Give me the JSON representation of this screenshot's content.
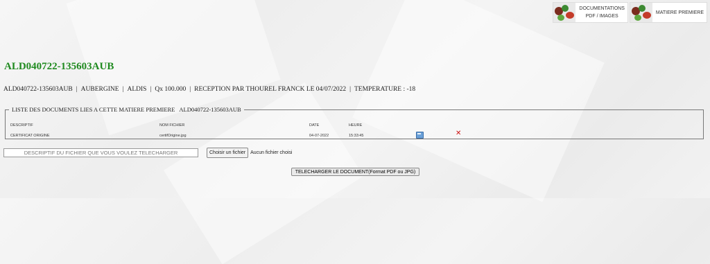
{
  "header": {
    "links": [
      {
        "label_line1": "DOCUMENTATIONS",
        "label_line2": "PDF / IMAGES"
      },
      {
        "label_line1": "MATIERE PREMIERE"
      }
    ]
  },
  "title": "ALD040722-135603AUB",
  "info": {
    "ref": "ALD040722-135603AUB",
    "product": "AUBERGINE",
    "supplier": "ALDIS",
    "quantity": "Qx 100.000",
    "reception": "RECEPTION PAR THOUREL FRANCK LE 04/07/2022",
    "temperature": "TEMPERATURE : -18"
  },
  "documents": {
    "legend": "LISTE DES DOCUMENTS LIES A CETTE MATIERE PREMIERE",
    "legend_ref": "ALD040722-135603AUB",
    "columns": [
      "DESCRIPTIF",
      "NOM FICHIER",
      "DATE",
      "HEURE"
    ],
    "rows": [
      {
        "descriptif": "CERTIFICAT ORIGINE",
        "fichier": "certifOrigine.jpg",
        "date": "04-07-2022",
        "heure": "15:33:45"
      }
    ]
  },
  "upload": {
    "description_placeholder": "DESCRIPTIF DU FICHIER QUE VOUS VOULEZ TELECHARGER",
    "choose_label": "Choisir un fichier",
    "status": "Aucun fichier choisi",
    "submit_label": "TELECHARGER LE DOCUMENT(Format PDF ou JPG)"
  }
}
